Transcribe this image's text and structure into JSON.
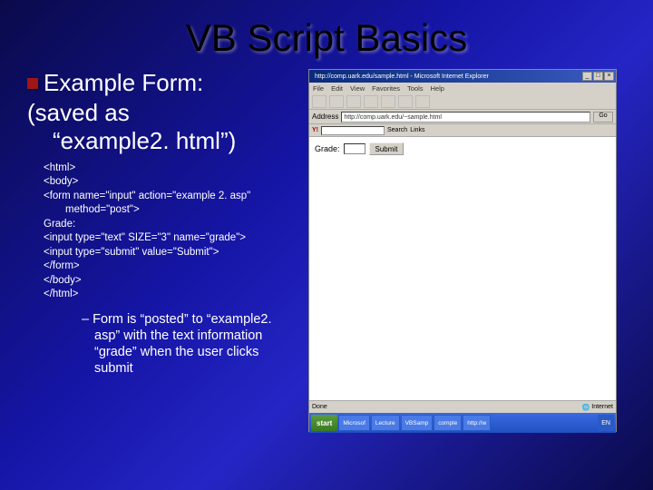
{
  "title": "VB Script Basics",
  "heading": "Example Form:",
  "subheading1": "(saved as",
  "subheading2": "“example2. html”)",
  "code": {
    "l1": "<html>",
    "l2": "<body>",
    "l3": "<form name=\"input\" action=\"example 2. asp\"",
    "l3b": "method=\"post\">",
    "l4": "Grade:",
    "l5": "<input type=\"text\" SIZE=\"3\" name=\"grade\">",
    "l6": "<input type=\"submit\" value=\"Submit\">",
    "l7": "</form>",
    "l8": "</body>",
    "l9": "</html>"
  },
  "note": "–   Form is “posted” to “example2. asp” with the text information “grade” when the user clicks submit",
  "browser": {
    "titlebar": "http://comp.uark.edu/sample.html - Microsoft Internet Explorer",
    "menu": {
      "file": "File",
      "edit": "Edit",
      "view": "View",
      "fav": "Favorites",
      "tools": "Tools",
      "help": "Help"
    },
    "addr_label": "Address",
    "addr_value": "http://comp.uark.edu/~sample.html",
    "go": "Go",
    "ylogo": "Y!",
    "ysearch": "Search",
    "ylinks": "Links",
    "grade_label": "Grade:",
    "submit": "Submit",
    "status_done": "Done",
    "status_zone": "Internet",
    "start": "start",
    "tasks": [
      "Microsof",
      "Lecture",
      "VBSamp",
      "comple",
      "http://w",
      "EN"
    ],
    "clock": ""
  }
}
